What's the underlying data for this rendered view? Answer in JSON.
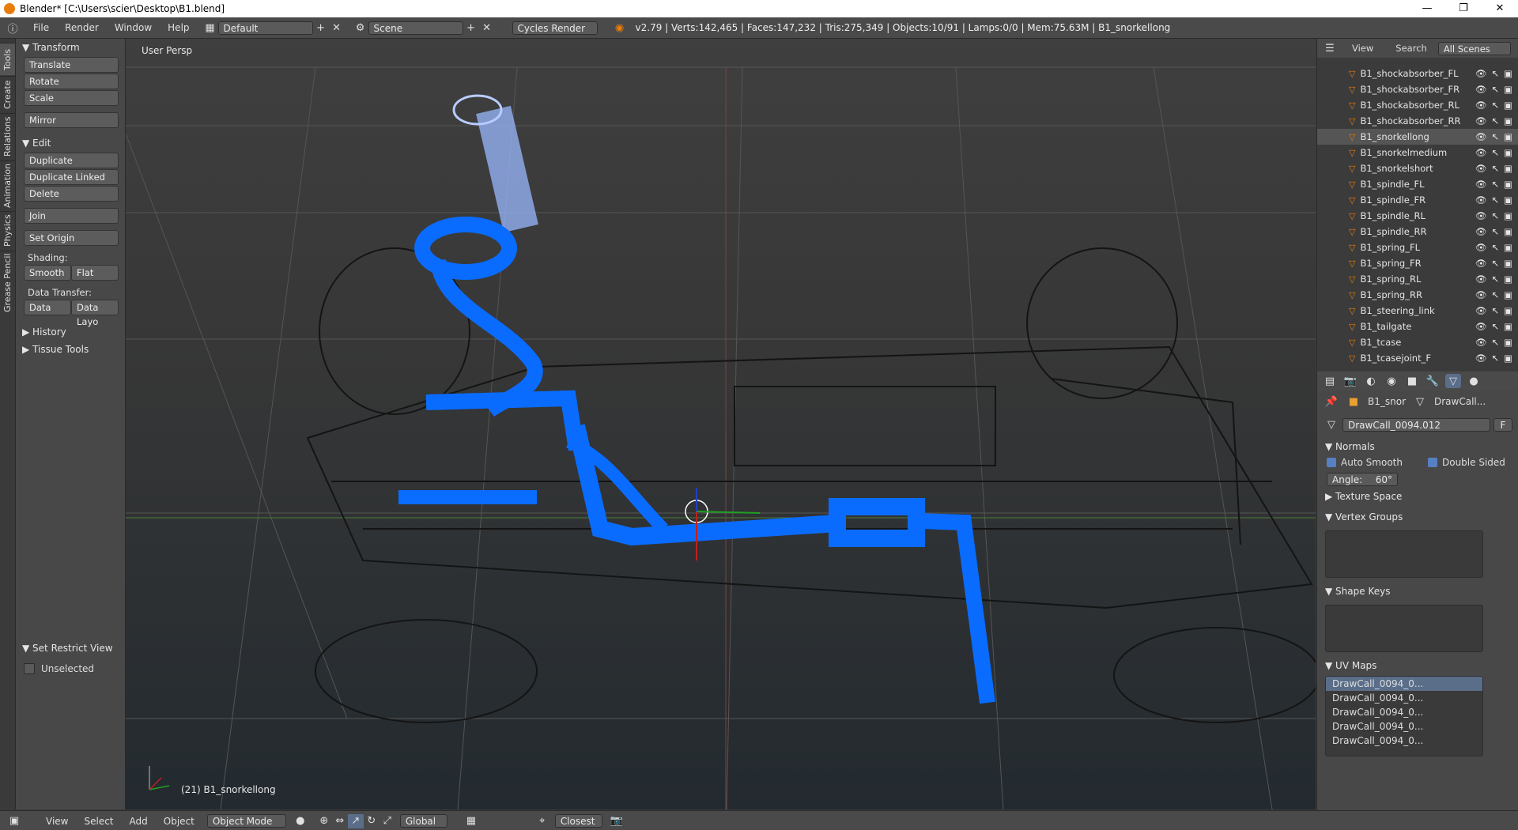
{
  "window": {
    "title": "Blender* [C:\\Users\\scier\\Desktop\\B1.blend]",
    "minimize": "—",
    "maximize": "❐",
    "close": "✕"
  },
  "menu": [
    "File",
    "Render",
    "Window",
    "Help"
  ],
  "layout_field": "Default",
  "scene_field": "Scene",
  "render_engine": "Cycles Render",
  "stats": "v2.79 | Verts:142,465 | Faces:147,232 | Tris:275,349 | Objects:10/91 | Lamps:0/0 | Mem:75.63M | B1_snorkellong",
  "left_tabs": [
    "Tools",
    "Create",
    "Relations",
    "Animation",
    "Physics",
    "Grease Pencil"
  ],
  "toolshelf": {
    "transform_head": "Transform",
    "transform": [
      "Translate",
      "Rotate",
      "Scale"
    ],
    "mirror": "Mirror",
    "edit_head": "Edit",
    "edit": [
      "Duplicate",
      "Duplicate Linked",
      "Delete"
    ],
    "join": "Join",
    "set_origin": "Set Origin",
    "shading_label": "Shading:",
    "smooth": "Smooth",
    "flat": "Flat",
    "data_transfer_label": "Data Transfer:",
    "data": "Data",
    "data_layout": "Data Layo",
    "history": "History",
    "tissue": "Tissue Tools",
    "restrict_head": "Set Restrict View",
    "unselected": "Unselected"
  },
  "viewport": {
    "label": "User Persp",
    "object": "(21) B1_snorkellong"
  },
  "outliner": {
    "tabs": [
      "View",
      "Search",
      "All Scenes"
    ],
    "items": [
      {
        "name": "B1_shockabsorber_FL",
        "selected": false
      },
      {
        "name": "B1_shockabsorber_FR",
        "selected": false
      },
      {
        "name": "B1_shockabsorber_RL",
        "selected": false
      },
      {
        "name": "B1_shockabsorber_RR",
        "selected": false
      },
      {
        "name": "B1_snorkellong",
        "selected": true
      },
      {
        "name": "B1_snorkelmedium",
        "selected": false
      },
      {
        "name": "B1_snorkelshort",
        "selected": false
      },
      {
        "name": "B1_spindle_FL",
        "selected": false
      },
      {
        "name": "B1_spindle_FR",
        "selected": false
      },
      {
        "name": "B1_spindle_RL",
        "selected": false
      },
      {
        "name": "B1_spindle_RR",
        "selected": false
      },
      {
        "name": "B1_spring_FL",
        "selected": false
      },
      {
        "name": "B1_spring_FR",
        "selected": false
      },
      {
        "name": "B1_spring_RL",
        "selected": false
      },
      {
        "name": "B1_spring_RR",
        "selected": false
      },
      {
        "name": "B1_steering_link",
        "selected": false
      },
      {
        "name": "B1_tailgate",
        "selected": false
      },
      {
        "name": "B1_tcase",
        "selected": false
      },
      {
        "name": "B1_tcasejoint_F",
        "selected": false
      }
    ]
  },
  "properties": {
    "breadcrumb_object": "B1_snor",
    "breadcrumb_data": "DrawCall...",
    "mesh_name": "DrawCall_0094.012",
    "fake_user": "F",
    "normals_head": "Normals",
    "auto_smooth": "Auto Smooth",
    "double_sided": "Double Sided",
    "angle_label": "Angle:",
    "angle_value": "60°",
    "texture_space": "Texture Space",
    "vertex_groups": "Vertex Groups",
    "shape_keys": "Shape Keys",
    "uv_maps_head": "UV Maps",
    "uv_maps": [
      "DrawCall_0094_0...",
      "DrawCall_0094_0...",
      "DrawCall_0094_0...",
      "DrawCall_0094_0...",
      "DrawCall_0094_0..."
    ]
  },
  "bottombar": {
    "menus": [
      "View",
      "Select",
      "Add",
      "Object"
    ],
    "mode": "Object Mode",
    "orientation": "Global",
    "snap": "Closest"
  },
  "colors": {
    "accent": "#e87d0d",
    "selected_mesh": "#0a6cff",
    "panel": "#484848"
  }
}
